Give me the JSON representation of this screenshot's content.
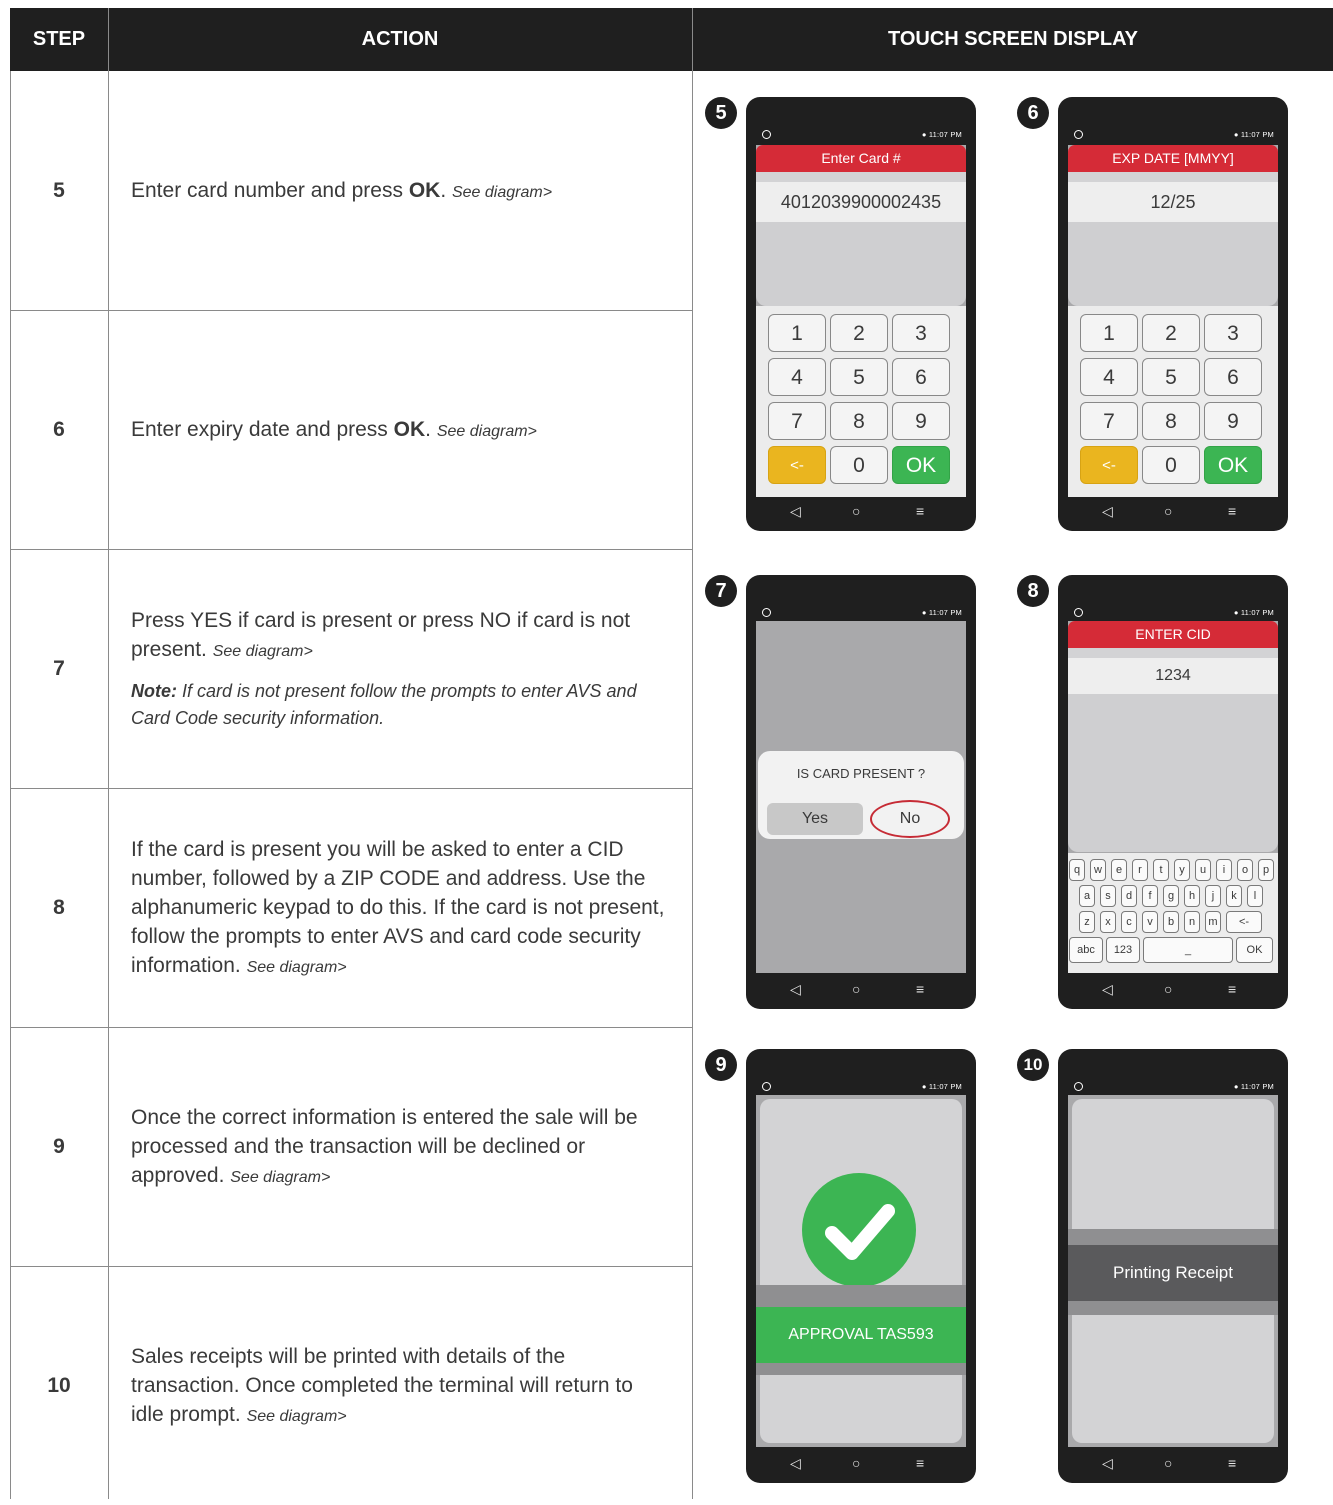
{
  "header": {
    "step": "STEP",
    "action": "ACTION",
    "display": "TOUCH SCREEN DISPLAY"
  },
  "rows": [
    {
      "step": "5",
      "text": "Enter card number and press ",
      "bold": "OK",
      "after": ". ",
      "see": "See diagram>"
    },
    {
      "step": "6",
      "text": "Enter expiry date and press ",
      "bold": "OK",
      "after": ". ",
      "see": "See diagram>"
    },
    {
      "step": "7",
      "text": "Press YES if card is present or press NO if card is not present.  ",
      "see": "See diagram>",
      "note_label": "Note:",
      "note_text": " If card is not present follow the prompts to enter AVS and Card Code security information."
    },
    {
      "step": "8",
      "text": "If the card is present you will be asked to enter a CID number, followed by a ZIP CODE and address. Use the alphanumeric keypad to do this. If the card is not present, follow the prompts to enter AVS and card code security information.  ",
      "see": "See diagram>"
    },
    {
      "step": "9",
      "text": "Once the correct information is entered the sale will be processed and the transaction will be declined or approved. ",
      "see": "See diagram>"
    },
    {
      "step": "10",
      "text": "Sales receipts will be printed with details of the transaction. Once completed the terminal will return to idle prompt.  ",
      "see": "See diagram>"
    }
  ],
  "status_time": "11:07 PM",
  "phones": {
    "p5": {
      "badge": "5",
      "title": "Enter Card #",
      "value": "4012039900002435"
    },
    "p6": {
      "badge": "6",
      "title": "EXP DATE [MMYY]",
      "value": "12/25"
    },
    "p7": {
      "badge": "7",
      "question": "IS CARD PRESENT ?",
      "yes": "Yes",
      "no": "No"
    },
    "p8": {
      "badge": "8",
      "title": "ENTER CID",
      "value": "1234"
    },
    "p9": {
      "badge": "9",
      "message": "APPROVAL TAS593"
    },
    "p10": {
      "badge": "10",
      "message": "Printing Receipt"
    }
  },
  "keypad": {
    "k1": "1",
    "k2": "2",
    "k3": "3",
    "k4": "4",
    "k5": "5",
    "k6": "6",
    "k7": "7",
    "k8": "8",
    "k9": "9",
    "back": "<-",
    "k0": "0",
    "ok": "OK"
  },
  "keyboard": {
    "row1": [
      "q",
      "w",
      "e",
      "r",
      "t",
      "y",
      "u",
      "i",
      "o",
      "p"
    ],
    "row2": [
      "a",
      "s",
      "d",
      "f",
      "g",
      "h",
      "j",
      "k",
      "l"
    ],
    "row3": [
      "z",
      "x",
      "c",
      "v",
      "b",
      "n",
      "m",
      "<-"
    ],
    "abc": "abc",
    "num": "123",
    "space": "_",
    "ok": "OK"
  },
  "nav": {
    "back": "◁",
    "home": "○",
    "menu": "≡"
  },
  "colors": {
    "title_red": "#d52b37",
    "ok_green": "#3cb553",
    "back_yellow": "#eab51f",
    "ring_red": "#c62b35"
  }
}
